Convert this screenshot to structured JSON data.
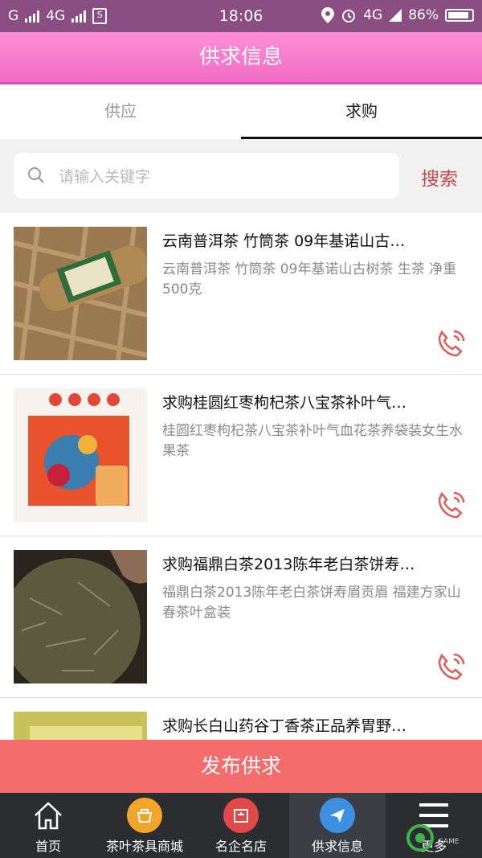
{
  "status_bar": {
    "carrier_left": "G",
    "network": "4G",
    "time": "18:06",
    "network_right": "4G",
    "battery": "86%"
  },
  "header": {
    "title": "供求信息"
  },
  "tabs": [
    {
      "label": "供应",
      "active": false
    },
    {
      "label": "求购",
      "active": true
    }
  ],
  "search": {
    "placeholder": "请输入关键字",
    "button_label": "搜索"
  },
  "listings": [
    {
      "title": "云南普洱茶 竹筒茶 09年基诺山古…",
      "description": "云南普洱茶 竹筒茶 09年基诺山古树茶 生茶 净重500克",
      "thumb_icon": "bamboo-tea-image"
    },
    {
      "title": "求购桂圆红枣枸杞茶八宝茶补叶气…",
      "description": "桂圆红枣枸杞茶八宝茶补叶气血花茶养袋装女生水果茶",
      "thumb_icon": "fruit-tea-box-image"
    },
    {
      "title": "求购福鼎白茶2013陈年老白茶饼寿…",
      "description": "福鼎白茶2013陈年老白茶饼寿眉贡眉 福建方家山春茶叶盒装",
      "thumb_icon": "white-tea-cake-image"
    },
    {
      "title": "求购长白山药谷丁香茶正品养胃野…",
      "description": "",
      "thumb_icon": "clove-tea-image"
    }
  ],
  "publish_button": {
    "label": "发布供求"
  },
  "tabbar": [
    {
      "label": "首页",
      "icon": "home-icon",
      "color": "#ffffff"
    },
    {
      "label": "茶叶茶具商城",
      "icon": "cart-icon",
      "color": "#f2a52b"
    },
    {
      "label": "名企名店",
      "icon": "shop-icon",
      "color": "#e24848"
    },
    {
      "label": "供求信息",
      "icon": "send-icon",
      "color": "#3d8fe0",
      "active": true
    },
    {
      "label": "更多",
      "icon": "menu-icon",
      "color": "#ffffff"
    }
  ],
  "watermark": {
    "text": "GAME"
  },
  "colors": {
    "header": "#f06cc6",
    "statusbar": "#8b4e82",
    "accent": "#f56c6c",
    "search_button": "#c44b4b"
  }
}
